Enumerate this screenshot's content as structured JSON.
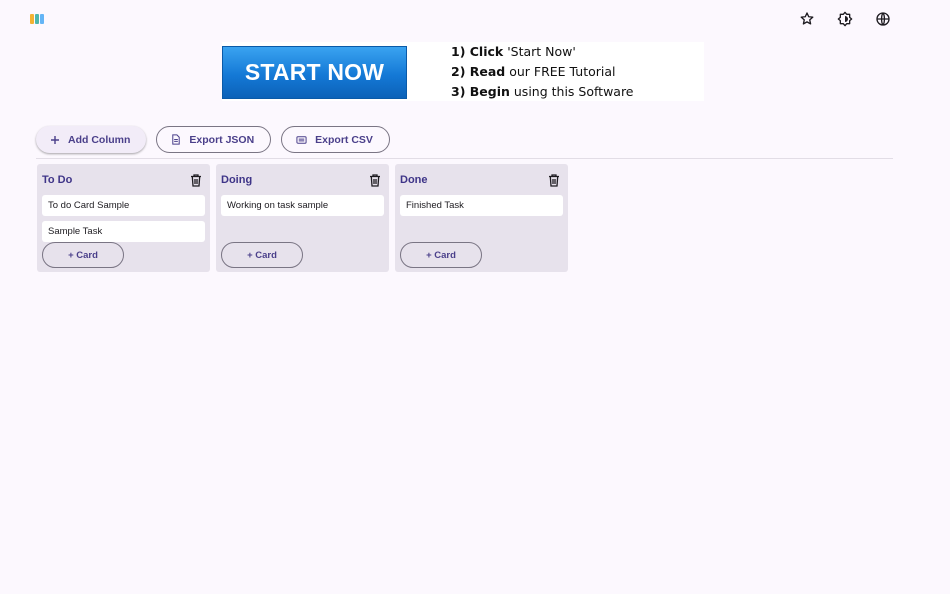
{
  "ad": {
    "button_label": "START NOW",
    "steps": [
      {
        "bold": "1) Click",
        "rest": " 'Start Now'"
      },
      {
        "bold": "2) Read",
        "rest": " our FREE Tutorial"
      },
      {
        "bold": "3) Begin",
        "rest": "  using  this Software"
      }
    ]
  },
  "header_icons": [
    "star-icon",
    "brightness-icon",
    "globe-icon"
  ],
  "toolbar": {
    "add_column_label": "Add Column",
    "export_json_label": "Export JSON",
    "export_csv_label": "Export CSV"
  },
  "columns": [
    {
      "title": "To Do",
      "cards": [
        "To do Card Sample",
        "Sample Task"
      ],
      "add_label": "+ Card"
    },
    {
      "title": "Doing",
      "cards": [
        "Working on task sample"
      ],
      "add_label": "+ Card"
    },
    {
      "title": "Done",
      "cards": [
        "Finished Task"
      ],
      "add_label": "+ Card"
    }
  ],
  "colors": {
    "accent": "#4a3f8a",
    "column_bg": "#e7e2ec",
    "page_bg": "#fcf8fe",
    "logo": [
      "#f2b233",
      "#4db6ac",
      "#64b5f6"
    ]
  }
}
